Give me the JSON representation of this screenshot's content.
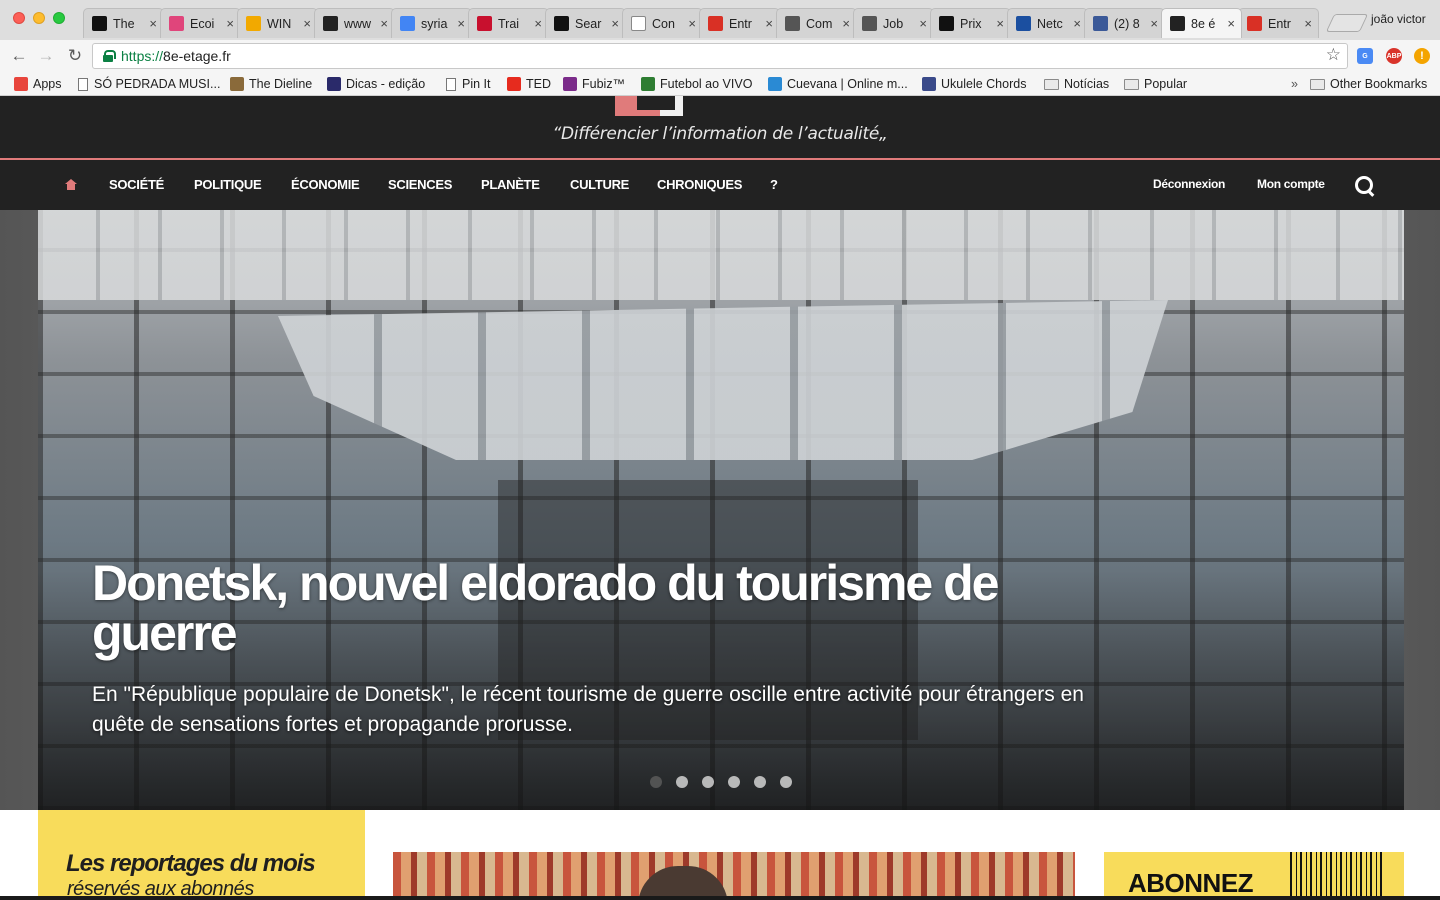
{
  "browser": {
    "profile_name": "joão victor",
    "tabs": [
      {
        "title": "The",
        "icon": "k-icon",
        "color": "#111111",
        "active": false
      },
      {
        "title": "Ecoi",
        "icon": "econ-icon",
        "color": "#e0457b",
        "active": false
      },
      {
        "title": "WIN",
        "icon": "win-icon",
        "color": "#f2a900",
        "active": false
      },
      {
        "title": "www",
        "icon": "c-icon",
        "color": "#222222",
        "active": false
      },
      {
        "title": "syria",
        "icon": "google-icon",
        "color": "#4285f4",
        "active": false
      },
      {
        "title": "Trai",
        "icon": "giz-icon",
        "color": "#c8102e",
        "active": false
      },
      {
        "title": "Sear",
        "icon": "k-icon",
        "color": "#111111",
        "active": false
      },
      {
        "title": "Con",
        "icon": "page-icon",
        "color": "#ffffff",
        "active": false
      },
      {
        "title": "Entr",
        "icon": "gmail-icon",
        "color": "#d93025",
        "active": false
      },
      {
        "title": "Com",
        "icon": "rw-icon",
        "color": "#555555",
        "active": false
      },
      {
        "title": "Job",
        "icon": "rw-icon",
        "color": "#555555",
        "active": false
      },
      {
        "title": "Prix",
        "icon": "flag-icon",
        "color": "#111111",
        "active": false
      },
      {
        "title": "Netc",
        "icon": "netc-icon",
        "color": "#1b4fa0",
        "active": false
      },
      {
        "title": "(2) 8",
        "icon": "facebook-icon",
        "color": "#3b5998",
        "active": false
      },
      {
        "title": "8e é",
        "icon": "8e-icon",
        "color": "#222222",
        "active": true
      },
      {
        "title": "Entr",
        "icon": "gmail-icon",
        "color": "#d93025",
        "active": false
      }
    ],
    "url_scheme": "https://",
    "url_host": "8e-etage.fr",
    "bookmarks": [
      {
        "label": "Apps",
        "icon": "apps-grid-icon"
      },
      {
        "label": "SÓ PEDRADA MUSI...",
        "icon": "page-icon"
      },
      {
        "label": "The Dieline",
        "icon": "dieline-icon"
      },
      {
        "label": "Dicas - edição",
        "icon": "cap-icon"
      },
      {
        "label": "Pin It",
        "icon": "page-icon"
      },
      {
        "label": "TED",
        "icon": "ted-icon"
      },
      {
        "label": "Fubiz™",
        "icon": "fubiz-icon"
      },
      {
        "label": "Futebol ao VIVO",
        "icon": "ball-icon"
      },
      {
        "label": "Cuevana | Online m...",
        "icon": "cuevana-icon"
      },
      {
        "label": "Ukulele Chords",
        "icon": "ukulele-icon"
      },
      {
        "label": "Notícias",
        "icon": "folder-icon"
      },
      {
        "label": "Popular",
        "icon": "folder-icon"
      }
    ],
    "bookmarks_overflow": "»",
    "other_bookmarks": "Other Bookmarks"
  },
  "site": {
    "tagline": "“Différencier l’information de l’actualité„",
    "nav": [
      "SOCIÉTÉ",
      "POLITIQUE",
      "ÉCONOMIE",
      "SCIENCES",
      "PLANÈTE",
      "CULTURE",
      "CHRONIQUES",
      "?"
    ],
    "account": {
      "logout": "Déconnexion",
      "my_account": "Mon compte"
    },
    "hero": {
      "title": "Donetsk, nouvel eldorado du tourisme de guerre",
      "subtitle": "En \"République populaire de Donetsk\", le récent tourisme de guerre oscille entre activité pour étrangers en quête de sensations fortes et propagande prorusse.",
      "slide_count": 6,
      "active_slide": 1
    },
    "promo": {
      "title": "Les reportages du mois",
      "subtitle": "réservés aux abonnés"
    },
    "subscribe": "ABONNEZ"
  },
  "colors": {
    "header_bg": "#222222",
    "accent_pink": "#e07b7b",
    "promo_yellow": "#f8dc5b"
  }
}
